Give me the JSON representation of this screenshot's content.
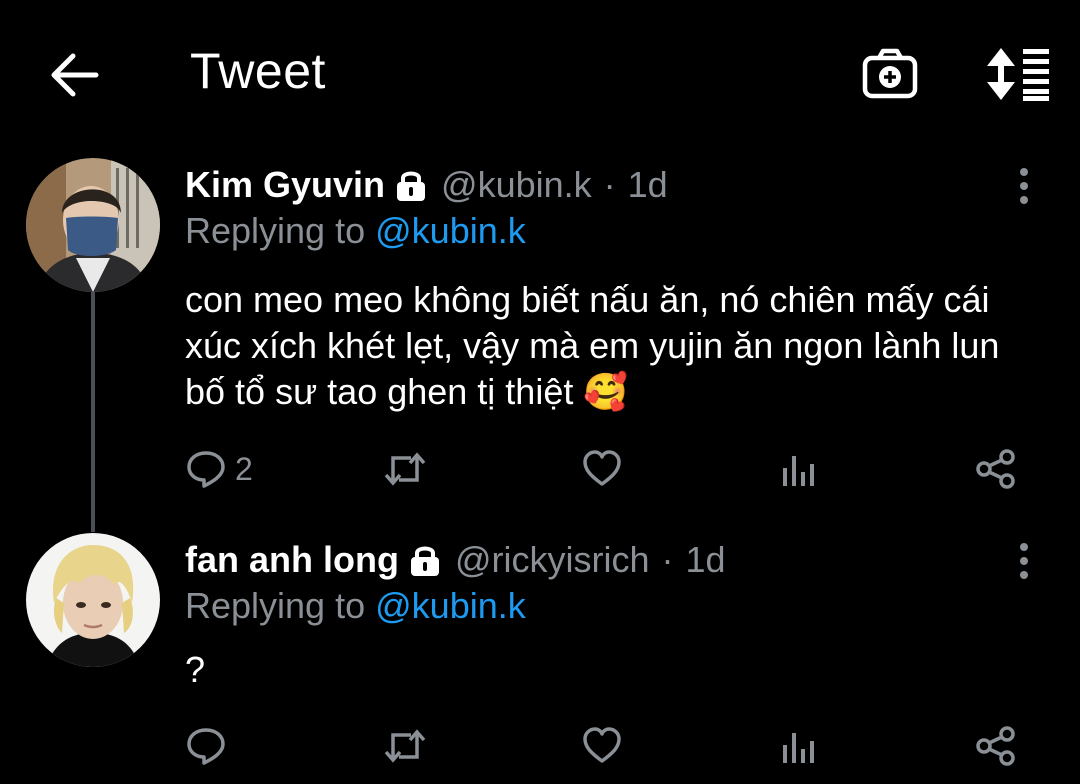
{
  "header": {
    "title": "Tweet",
    "back_icon": "arrow-left-icon",
    "camera_icon": "camera-plus-icon",
    "sort_icon": "sort-icon"
  },
  "tweets": [
    {
      "name": "Kim Gyuvin",
      "handle": "@kubin.k",
      "dot": "·",
      "time": "1d",
      "replying_prefix": "Replying to",
      "replying_mention": "@kubin.k",
      "text": "con meo meo không biết nấu ăn, nó chiên mấy cái xúc xích khét lẹt, vậy mà em yujin ăn ngon lành lun bố tổ sư tao ghen tị thiệt 🥰",
      "reply_count": "2"
    },
    {
      "name": "fan anh long",
      "handle": "@rickyisrich",
      "dot": "·",
      "time": "1d",
      "replying_prefix": "Replying to",
      "replying_mention": "@kubin.k",
      "text": "?",
      "reply_count": ""
    }
  ],
  "colors": {
    "background": "#000000",
    "text": "#ffffff",
    "secondary": "#8a9096",
    "accent": "#1d9bf0"
  }
}
